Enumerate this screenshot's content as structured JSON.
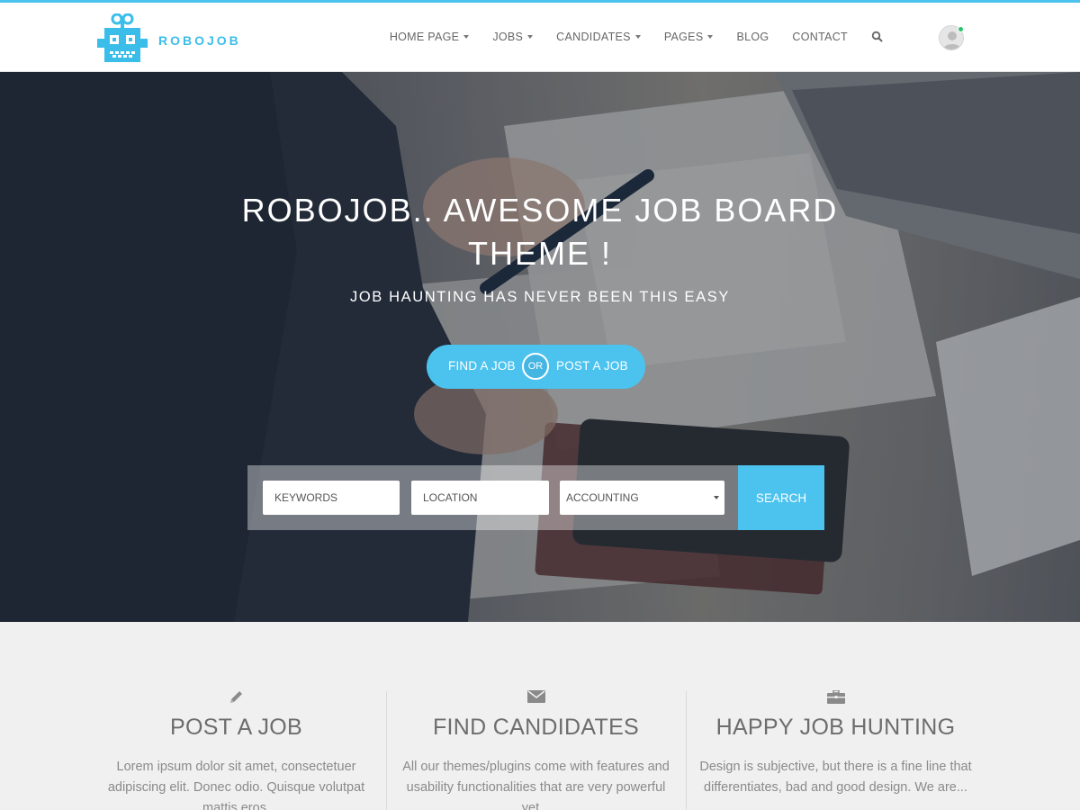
{
  "brand": {
    "name": "ROBOJOB"
  },
  "nav": {
    "items": [
      {
        "label": "HOME PAGE",
        "dropdown": true
      },
      {
        "label": "JOBS",
        "dropdown": true
      },
      {
        "label": "CANDIDATES",
        "dropdown": true
      },
      {
        "label": "PAGES",
        "dropdown": true
      },
      {
        "label": "BLOG",
        "dropdown": false
      },
      {
        "label": "CONTACT",
        "dropdown": false
      }
    ],
    "search_icon": "search-icon",
    "avatar_icon": "user-avatar-icon",
    "status": "online"
  },
  "hero": {
    "title": "ROBOJOB.. AWESOME JOB BOARD THEME !",
    "subtitle": "JOB HAUNTING HAS NEVER BEEN THIS EASY",
    "cta": {
      "find": "FIND A JOB",
      "or": "OR",
      "post": "POST A JOB"
    }
  },
  "search": {
    "keywords_placeholder": "KEYWORDS",
    "location_placeholder": "LOCATION",
    "category_selected": "ACCOUNTING",
    "button": "SEARCH"
  },
  "features": [
    {
      "icon": "pencil-icon",
      "title": "POST A JOB",
      "text": "Lorem ipsum dolor sit amet, consectetuer adipiscing elit. Donec odio. Quisque volutpat mattis eros."
    },
    {
      "icon": "envelope-icon",
      "title": "FIND CANDIDATES",
      "text": "All our themes/plugins come with features and usability functionalities that are very powerful yet..."
    },
    {
      "icon": "briefcase-icon",
      "title": "HAPPY JOB HUNTING",
      "text": "Design is subjective, but there is a fine line that differentiates, bad and good design. We are..."
    }
  ],
  "colors": {
    "accent": "#4cc3ee",
    "online": "#27c46b",
    "text_muted": "#8a8a8a"
  }
}
